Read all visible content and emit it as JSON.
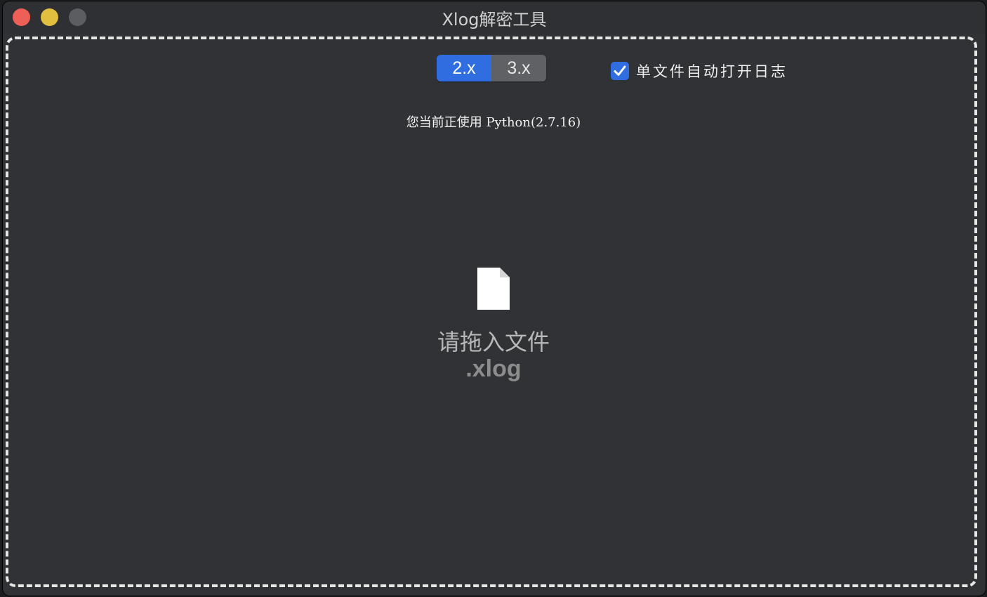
{
  "window": {
    "title": "Xlog解密工具"
  },
  "version_switch": {
    "options": [
      "2.x",
      "3.x"
    ],
    "selected": "2.x"
  },
  "auto_open": {
    "label": "单文件自动打开日志",
    "checked": true
  },
  "python_info": "您当前正使用 Python(2.7.16)",
  "dropzone": {
    "prompt": "请拖入文件",
    "extension": ".xlog"
  },
  "icons": {
    "file": "file-icon",
    "check": "checkmark-icon"
  },
  "colors": {
    "accent": "#2f6de1",
    "background": "#303236",
    "close": "#ee5f57",
    "minimize": "#e3bf40"
  }
}
